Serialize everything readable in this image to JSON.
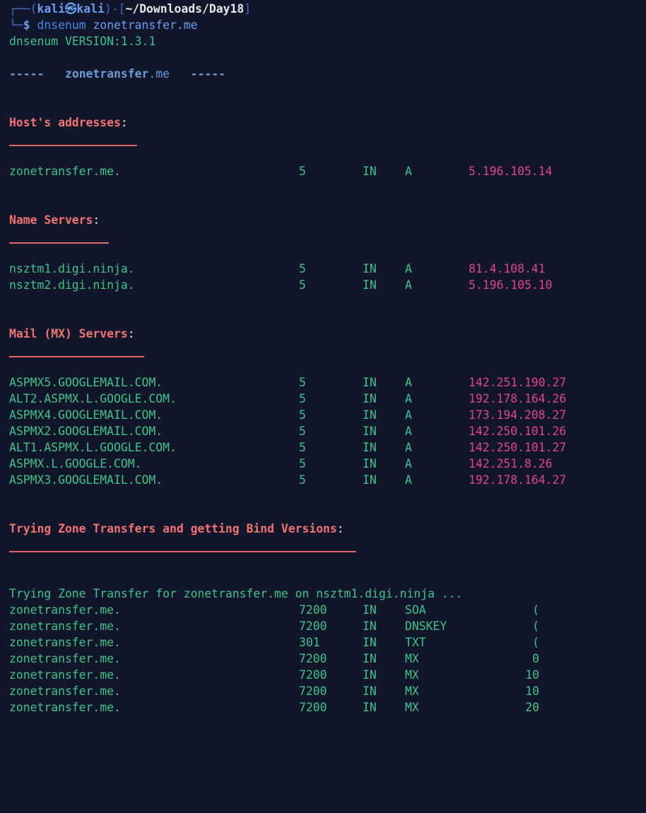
{
  "prompt": {
    "user": "kali",
    "at": "㉿",
    "host": "kali",
    "path": "~/Downloads/Day18",
    "command": "dnsenum",
    "argument": "zonetransfer.me"
  },
  "version_line": "dnsenum VERSION:1.3.1",
  "banner": {
    "left": "-----",
    "domain": "zonetransfer",
    "tld": ".me",
    "right": "-----"
  },
  "sections": {
    "host_addresses": {
      "title": "Host's addresses",
      "rows": [
        {
          "host": "zonetransfer.me.",
          "ttl": "5",
          "class": "IN",
          "type": "A",
          "ip": "5.196.105.14"
        }
      ]
    },
    "name_servers": {
      "title": "Name Servers",
      "rows": [
        {
          "host": "nsztm1.digi.ninja.",
          "ttl": "5",
          "class": "IN",
          "type": "A",
          "ip": "81.4.108.41"
        },
        {
          "host": "nsztm2.digi.ninja.",
          "ttl": "5",
          "class": "IN",
          "type": "A",
          "ip": "5.196.105.10"
        }
      ]
    },
    "mail_servers": {
      "title": "Mail (MX) Servers",
      "rows": [
        {
          "host": "ASPMX5.GOOGLEMAIL.COM.",
          "ttl": "5",
          "class": "IN",
          "type": "A",
          "ip": "142.251.190.27"
        },
        {
          "host": "ALT2.ASPMX.L.GOOGLE.COM.",
          "ttl": "5",
          "class": "IN",
          "type": "A",
          "ip": "192.178.164.26"
        },
        {
          "host": "ASPMX4.GOOGLEMAIL.COM.",
          "ttl": "5",
          "class": "IN",
          "type": "A",
          "ip": "173.194.208.27"
        },
        {
          "host": "ASPMX2.GOOGLEMAIL.COM.",
          "ttl": "5",
          "class": "IN",
          "type": "A",
          "ip": "142.250.101.26"
        },
        {
          "host": "ALT1.ASPMX.L.GOOGLE.COM.",
          "ttl": "5",
          "class": "IN",
          "type": "A",
          "ip": "142.250.101.27"
        },
        {
          "host": "ASPMX.L.GOOGLE.COM.",
          "ttl": "5",
          "class": "IN",
          "type": "A",
          "ip": "142.251.8.26"
        },
        {
          "host": "ASPMX3.GOOGLEMAIL.COM.",
          "ttl": "5",
          "class": "IN",
          "type": "A",
          "ip": "192.178.164.27"
        }
      ]
    },
    "zone_transfers": {
      "title": "Trying Zone Transfers and getting Bind Versions",
      "attempt_line": "Trying Zone Transfer for zonetransfer.me on nsztm1.digi.ninja ...",
      "rows": [
        {
          "host": "zonetransfer.me.",
          "ttl": "7200",
          "class": "IN",
          "type": "SOA",
          "value": "("
        },
        {
          "host": "zonetransfer.me.",
          "ttl": "7200",
          "class": "IN",
          "type": "DNSKEY",
          "value": "("
        },
        {
          "host": "zonetransfer.me.",
          "ttl": "301",
          "class": "IN",
          "type": "TXT",
          "value": "("
        },
        {
          "host": "zonetransfer.me.",
          "ttl": "7200",
          "class": "IN",
          "type": "MX",
          "value": "0"
        },
        {
          "host": "zonetransfer.me.",
          "ttl": "7200",
          "class": "IN",
          "type": "MX",
          "value": "10"
        },
        {
          "host": "zonetransfer.me.",
          "ttl": "7200",
          "class": "IN",
          "type": "MX",
          "value": "10"
        },
        {
          "host": "zonetransfer.me.",
          "ttl": "7200",
          "class": "IN",
          "type": "MX",
          "value": "20"
        }
      ]
    }
  },
  "colors": {
    "background": "#12162a",
    "record_text": "#3ec38a",
    "ip_text": "#e0458c",
    "heading": "#f27272",
    "prompt": "#6a9ff0"
  }
}
